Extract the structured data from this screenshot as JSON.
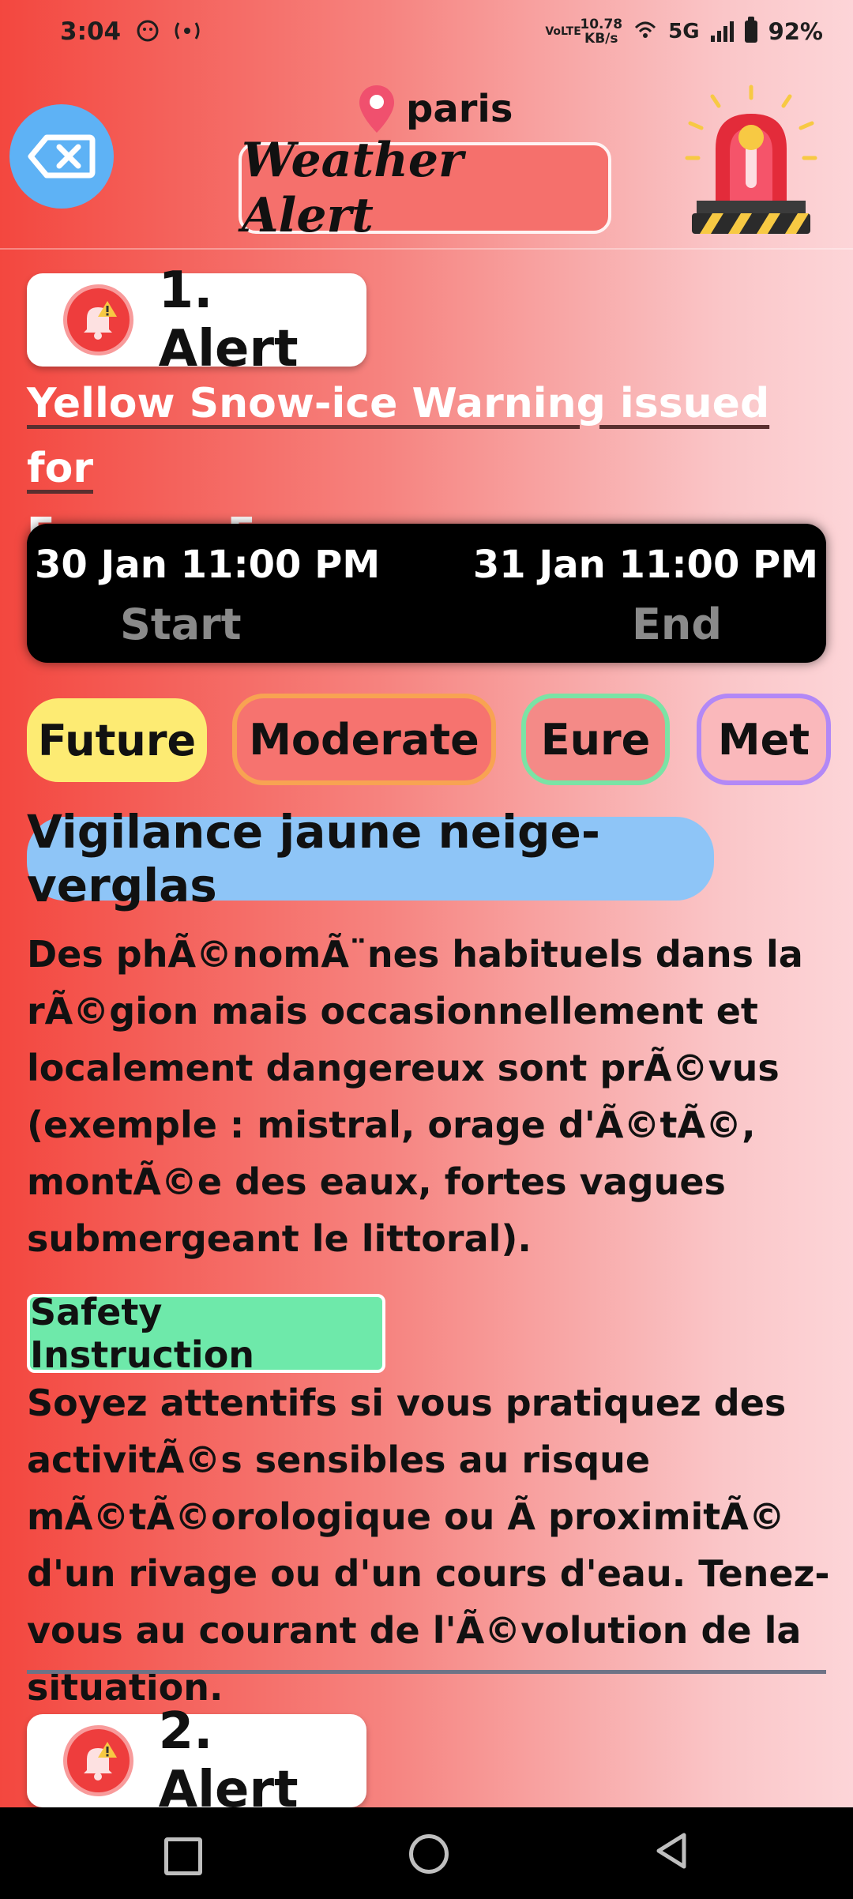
{
  "status_bar": {
    "time": "3:04",
    "net_type": "VoLTE",
    "net_speed_value": "10.78",
    "net_speed_unit": "KB/s",
    "network": "5G",
    "battery": "92%"
  },
  "header": {
    "city": "paris",
    "title": "Weather Alert",
    "back_icon": "backspace-icon",
    "siren_icon": "siren-icon"
  },
  "alerts": [
    {
      "label": "1. Alert",
      "headline_line1": "Yellow Snow-ice Warning issued for",
      "headline_line2": "France - Eure",
      "start_time": "30 Jan 11:00 PM",
      "end_time": "31 Jan 11:00 PM",
      "start_label": "Start",
      "end_label": "End",
      "urgency": "Future",
      "severity": "Moderate",
      "area": "Eure",
      "category": "Met",
      "event": "Vigilance jaune neige-verglas",
      "description": "Des phÃ©nomÃ¨nes habituels dans la rÃ©gion mais occasionnellement et localement dangereux sont prÃ©vus (exemple : mistral, orage d'Ã©tÃ©, montÃ©e des eaux, fortes vagues submergeant le littoral).",
      "safety_label": "Safety Instruction",
      "instruction": "Soyez attentifs si vous pratiquez des activitÃ©s sensibles au risque mÃ©tÃ©orologique ou Ã  proximitÃ© d'un rivage ou d'un cours d'eau. Tenez-vous au courant de l'Ã©volution de la situation."
    },
    {
      "label": "2. Alert"
    }
  ],
  "colors": {
    "future_chip": "#fdeb73",
    "moderate_border": "#f8a352",
    "eure_border": "#7ae3a5",
    "met_border": "#b288f6",
    "event_chip": "#8ec5f7",
    "safety_chip": "#6ee9aa",
    "back_button": "#5eb2f5"
  }
}
